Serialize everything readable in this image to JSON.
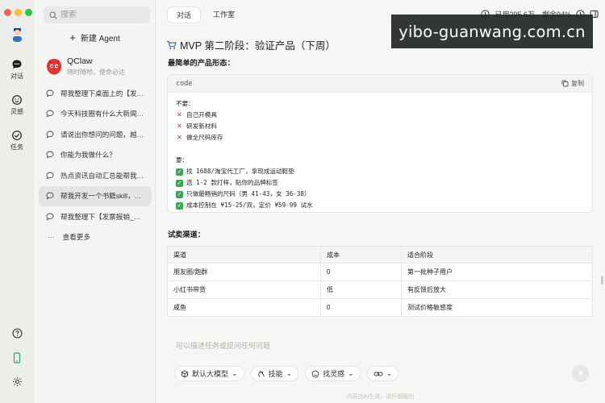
{
  "rail": {
    "items": [
      {
        "label": "对话",
        "icon": "chat-icon"
      },
      {
        "label": "灵感",
        "icon": "inspiration-icon"
      },
      {
        "label": "任务",
        "icon": "task-icon"
      }
    ]
  },
  "sidebar": {
    "search_placeholder": "搜索",
    "new_agent": "新建 Agent",
    "agent": {
      "name": "QClaw",
      "subtitle": "随时随地，使命必达"
    },
    "conversations": [
      {
        "title": "帮我整理下桌面上的【发票报..."
      },
      {
        "title": "今天科技圈有什么大新闻，整..."
      },
      {
        "title": "请说出你想问的问题，越具体..."
      },
      {
        "title": "你能为我做什么？"
      },
      {
        "title": "热点资讯自动汇总能帮我做..."
      },
      {
        "title": "帮我开发一个书籍skill，能..."
      },
      {
        "title": "帮我整理下【发票报销_副本..."
      }
    ],
    "active_index": 5,
    "more": "查看更多"
  },
  "main": {
    "tabs": [
      "对话",
      "工作室"
    ],
    "active_tab": 0,
    "usage": "已用295.6万，剩余94%",
    "heading": "MVP 第二阶段：验证产品（下周）",
    "subheading": "最简单的产品形态：",
    "code": {
      "lang": "code",
      "copy": "复制",
      "no_label": "不要：",
      "no_items": [
        "自己开模具",
        "研发新材料",
        "做全尺码库存"
      ],
      "yes_label": "要：",
      "yes_items": [
        "找 1688/淘宝代工厂，拿现成运动鞋垫",
        "选 1-2 款打样，贴你的品牌标签",
        "只做最畅销的尺码（男 41-43，女 36-38）",
        "成本控制在 ¥15-25/双，定价 ¥59-99 试水"
      ]
    },
    "channels_title": "试卖渠道：",
    "table": {
      "headers": [
        "渠道",
        "成本",
        "适合阶段"
      ],
      "rows": [
        [
          "朋友圈/跑群",
          "0",
          "第一批种子用户"
        ],
        [
          "小红书带货",
          "低",
          "有反馈后放大"
        ],
        [
          "咸鱼",
          "0",
          "测试价格敏感度"
        ]
      ]
    },
    "composer_placeholder": "可以描述任务或提问任何问题",
    "tools": [
      "默认大模型",
      "技能",
      "找灵感"
    ],
    "footer": "内容由AI生成，请仔细甄别"
  },
  "watermark": "yibo-guanwang.com.cn"
}
